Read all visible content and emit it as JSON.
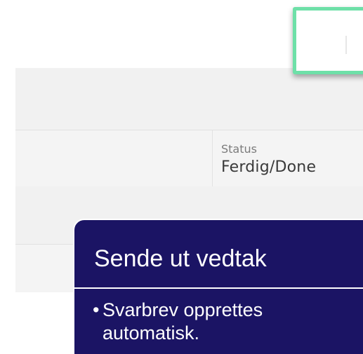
{
  "status_panel": {
    "status_label": "Status",
    "status_value": "Ferdig/Done"
  },
  "callout": {
    "title": "Sende ut vedtak",
    "bullet_symbol": "•",
    "bullet_text": "Svarbrev opprettes automatisk."
  },
  "colors": {
    "highlight": "#6ee0a8",
    "callout_bg": "#1b1464",
    "panel_bg": "#f1f1f1"
  }
}
